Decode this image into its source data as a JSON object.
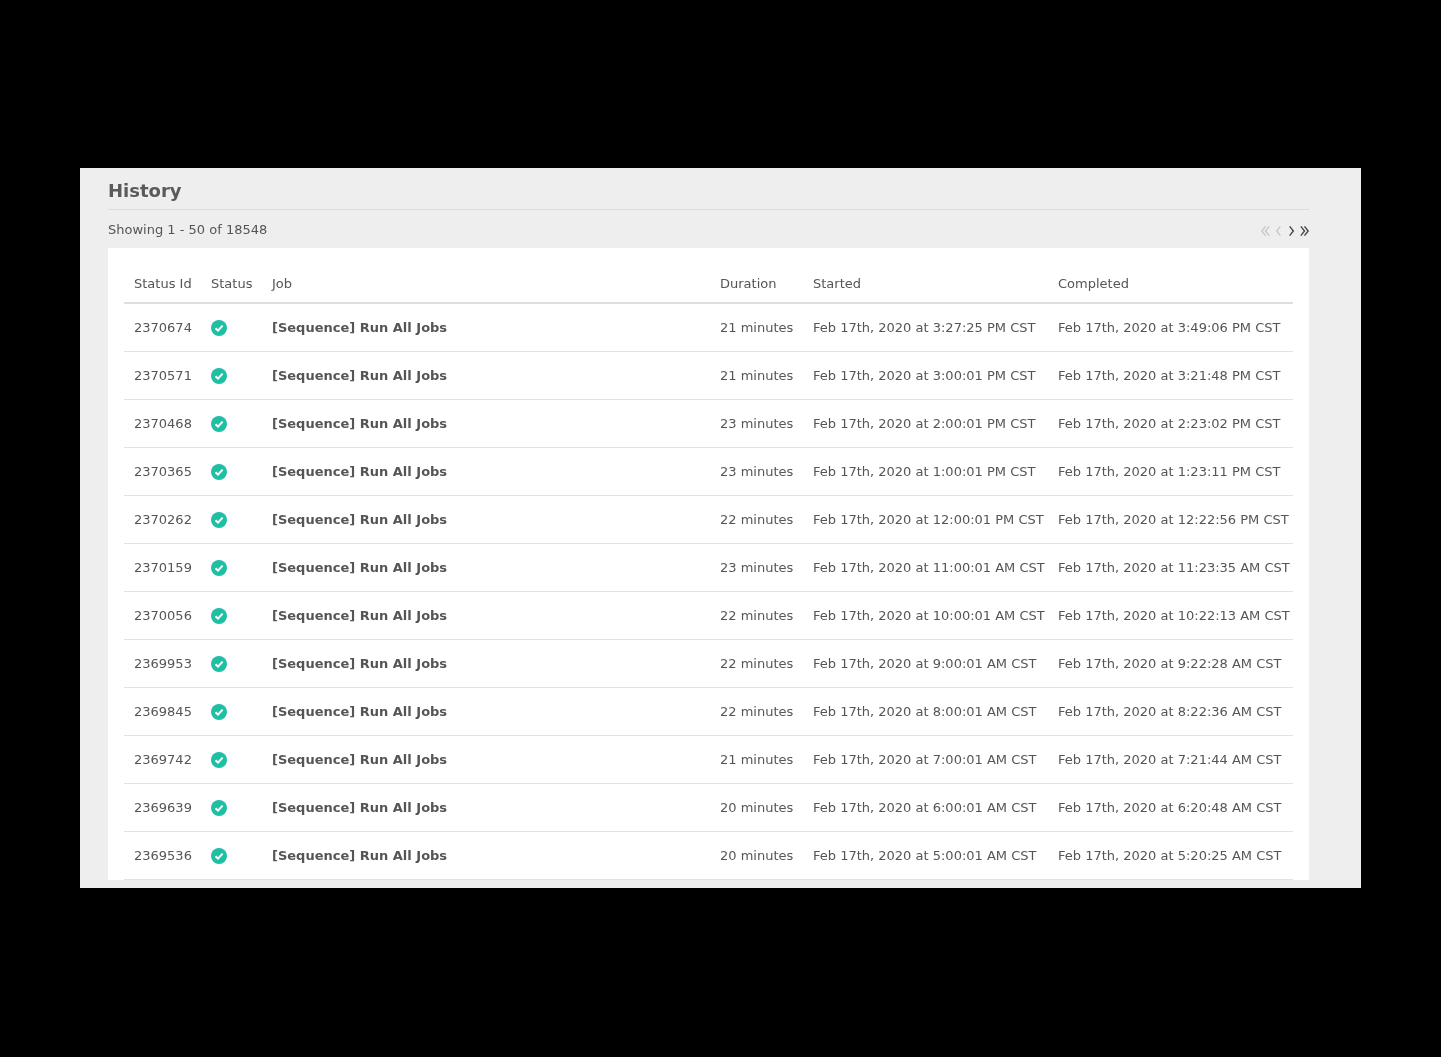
{
  "panel": {
    "title": "History",
    "summary": "Showing 1 - 50 of 18548",
    "pagination": [
      {
        "kind": "first",
        "disabled": true
      },
      {
        "kind": "prev",
        "disabled": true
      },
      {
        "kind": "next",
        "disabled": false
      },
      {
        "kind": "last",
        "disabled": false
      }
    ]
  },
  "table": {
    "columns": [
      "Status Id",
      "Status",
      "Job",
      "Duration",
      "Started",
      "Completed"
    ],
    "rows": [
      {
        "id": "2370674",
        "succeeded": true,
        "job": "[Sequence] Run All Jobs",
        "duration": "21 minutes",
        "started": "Feb 17th, 2020 at 3:27:25 PM CST",
        "completed": "Feb 17th, 2020 at 3:49:06 PM CST"
      },
      {
        "id": "2370571",
        "succeeded": true,
        "job": "[Sequence] Run All Jobs",
        "duration": "21 minutes",
        "started": "Feb 17th, 2020 at 3:00:01 PM CST",
        "completed": "Feb 17th, 2020 at 3:21:48 PM CST"
      },
      {
        "id": "2370468",
        "succeeded": true,
        "job": "[Sequence] Run All Jobs",
        "duration": "23 minutes",
        "started": "Feb 17th, 2020 at 2:00:01 PM CST",
        "completed": "Feb 17th, 2020 at 2:23:02 PM CST"
      },
      {
        "id": "2370365",
        "succeeded": true,
        "job": "[Sequence] Run All Jobs",
        "duration": "23 minutes",
        "started": "Feb 17th, 2020 at 1:00:01 PM CST",
        "completed": "Feb 17th, 2020 at 1:23:11 PM CST"
      },
      {
        "id": "2370262",
        "succeeded": true,
        "job": "[Sequence] Run All Jobs",
        "duration": "22 minutes",
        "started": "Feb 17th, 2020 at 12:00:01 PM CST",
        "completed": "Feb 17th, 2020 at 12:22:56 PM CST"
      },
      {
        "id": "2370159",
        "succeeded": true,
        "job": "[Sequence] Run All Jobs",
        "duration": "23 minutes",
        "started": "Feb 17th, 2020 at 11:00:01 AM CST",
        "completed": "Feb 17th, 2020 at 11:23:35 AM CST"
      },
      {
        "id": "2370056",
        "succeeded": true,
        "job": "[Sequence] Run All Jobs",
        "duration": "22 minutes",
        "started": "Feb 17th, 2020 at 10:00:01 AM CST",
        "completed": "Feb 17th, 2020 at 10:22:13 AM CST"
      },
      {
        "id": "2369953",
        "succeeded": true,
        "job": "[Sequence] Run All Jobs",
        "duration": "22 minutes",
        "started": "Feb 17th, 2020 at 9:00:01 AM CST",
        "completed": "Feb 17th, 2020 at 9:22:28 AM CST"
      },
      {
        "id": "2369845",
        "succeeded": true,
        "job": "[Sequence] Run All Jobs",
        "duration": "22 minutes",
        "started": "Feb 17th, 2020 at 8:00:01 AM CST",
        "completed": "Feb 17th, 2020 at 8:22:36 AM CST"
      },
      {
        "id": "2369742",
        "succeeded": true,
        "job": "[Sequence] Run All Jobs",
        "duration": "21 minutes",
        "started": "Feb 17th, 2020 at 7:00:01 AM CST",
        "completed": "Feb 17th, 2020 at 7:21:44 AM CST"
      },
      {
        "id": "2369639",
        "succeeded": true,
        "job": "[Sequence] Run All Jobs",
        "duration": "20 minutes",
        "started": "Feb 17th, 2020 at 6:00:01 AM CST",
        "completed": "Feb 17th, 2020 at 6:20:48 AM CST"
      },
      {
        "id": "2369536",
        "succeeded": true,
        "job": "[Sequence] Run All Jobs",
        "duration": "20 minutes",
        "started": "Feb 17th, 2020 at 5:00:01 AM CST",
        "completed": "Feb 17th, 2020 at 5:20:25 AM CST"
      }
    ]
  }
}
